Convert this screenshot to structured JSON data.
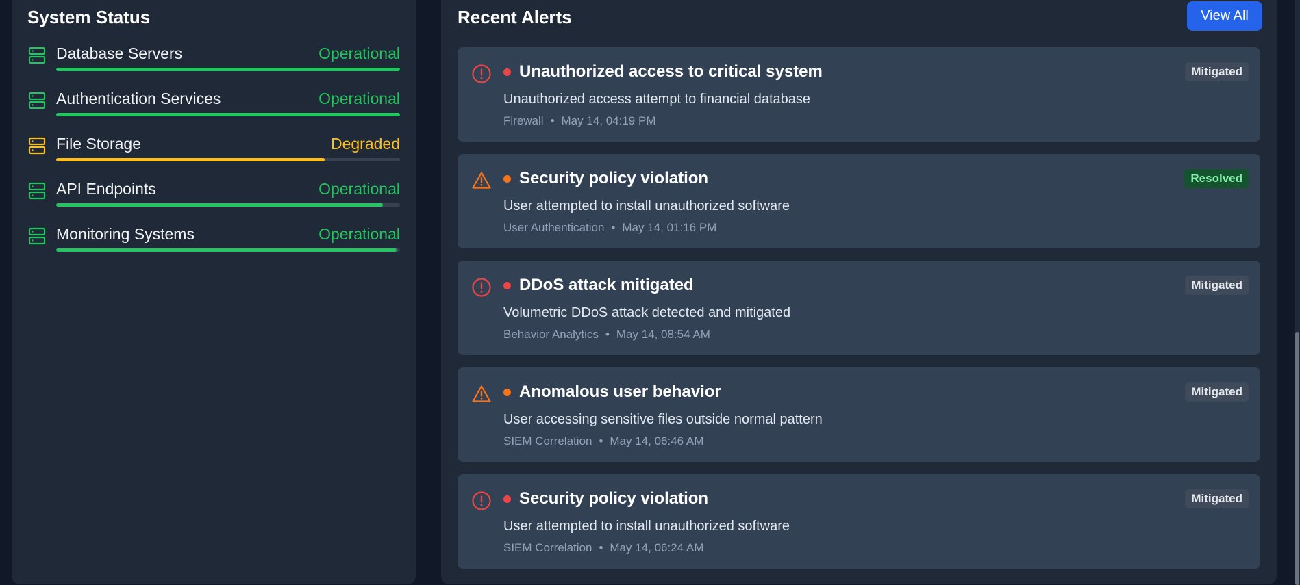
{
  "system_status": {
    "title": "System Status",
    "items": [
      {
        "name": "Database Servers",
        "state": "Operational",
        "color": "#22c55e",
        "level": 1.0
      },
      {
        "name": "Authentication Services",
        "state": "Operational",
        "color": "#22c55e",
        "level": 1.0
      },
      {
        "name": "File Storage",
        "state": "Degraded",
        "color": "#fbbf24",
        "level": 0.78
      },
      {
        "name": "API Endpoints",
        "state": "Operational",
        "color": "#22c55e",
        "level": 0.95
      },
      {
        "name": "Monitoring Systems",
        "state": "Operational",
        "color": "#22c55e",
        "level": 0.99
      }
    ]
  },
  "alerts": {
    "title": "Recent Alerts",
    "view_all_label": "View All",
    "items": [
      {
        "icon": "alert-circle-icon",
        "dot_color": "#ef4444",
        "title": "Unauthorized access to critical system",
        "description": "Unauthorized access attempt to financial database",
        "source": "Firewall",
        "time": "May 14, 04:19 PM",
        "status": "Mitigated"
      },
      {
        "icon": "alert-triangle-icon",
        "dot_color": "#f97316",
        "title": "Security policy violation",
        "description": "User attempted to install unauthorized software",
        "source": "User Authentication",
        "time": "May 14, 01:16 PM",
        "status": "Resolved"
      },
      {
        "icon": "alert-circle-icon",
        "dot_color": "#ef4444",
        "title": "DDoS attack mitigated",
        "description": "Volumetric DDoS attack detected and mitigated",
        "source": "Behavior Analytics",
        "time": "May 14, 08:54 AM",
        "status": "Mitigated"
      },
      {
        "icon": "alert-triangle-icon",
        "dot_color": "#f97316",
        "title": "Anomalous user behavior",
        "description": "User accessing sensitive files outside normal pattern",
        "source": "SIEM Correlation",
        "time": "May 14, 06:46 AM",
        "status": "Mitigated"
      },
      {
        "icon": "alert-circle-icon",
        "dot_color": "#ef4444",
        "title": "Security policy violation",
        "description": "User attempted to install unauthorized software",
        "source": "SIEM Correlation",
        "time": "May 14, 06:24 AM",
        "status": "Mitigated"
      }
    ]
  }
}
